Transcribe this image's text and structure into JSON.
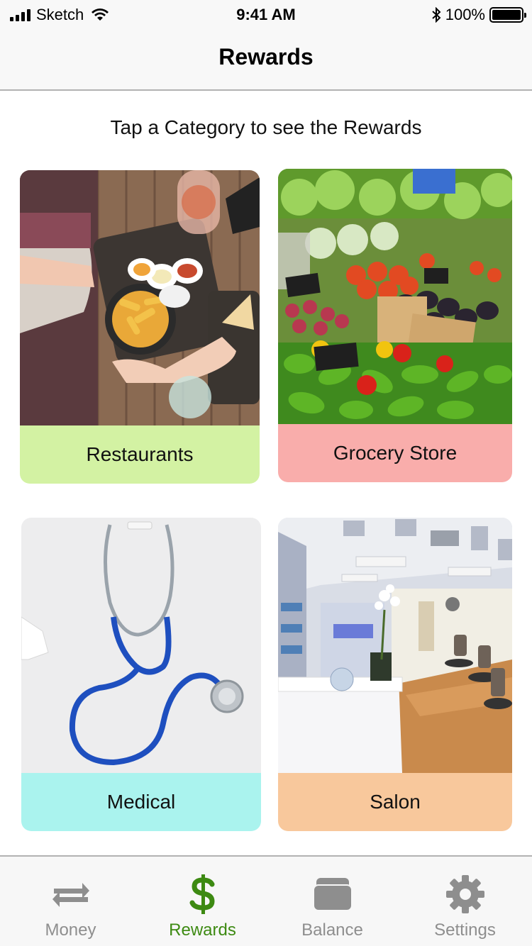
{
  "status_bar": {
    "carrier": "Sketch",
    "time": "9:41 AM",
    "battery": "100%"
  },
  "nav": {
    "title": "Rewards"
  },
  "subtitle": "Tap a Category to see the Rewards",
  "categories": [
    {
      "label": "Restaurants",
      "color": "#d3f2a3",
      "image": "restaurant-table-photo"
    },
    {
      "label": "Grocery Store",
      "color": "#f9adab",
      "image": "vegetable-market-photo"
    },
    {
      "label": "Medical",
      "color": "#aaf3ee",
      "image": "stethoscope-photo"
    },
    {
      "label": "Salon",
      "color": "#f8c89c",
      "image": "salon-interior-photo"
    }
  ],
  "tabbar": {
    "items": [
      {
        "label": "Money",
        "icon": "transfer-arrows-icon",
        "active": false
      },
      {
        "label": "Rewards",
        "icon": "dollar-icon",
        "active": true
      },
      {
        "label": "Balance",
        "icon": "wallet-icon",
        "active": false
      },
      {
        "label": "Settings",
        "icon": "gear-icon",
        "active": false
      }
    ],
    "active_color": "#3d8a12",
    "inactive_color": "#8e8e8e"
  }
}
